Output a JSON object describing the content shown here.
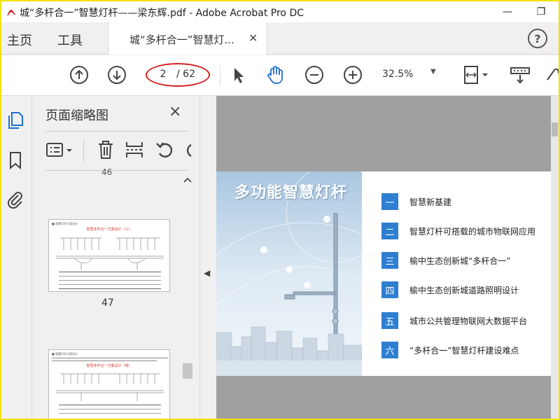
{
  "window": {
    "title": "城“多杆合一”智慧灯杆——梁东辉.pdf - Adobe Acrobat Pro DC",
    "minimize_glyph": "—",
    "restore_glyph": "❐"
  },
  "menu": {
    "home": "主页",
    "tools": "工具"
  },
  "doc_tab": {
    "label": "城“多杆合一”智慧灯...",
    "close": "×"
  },
  "help": "?",
  "toolbar": {
    "current_page": "2",
    "total_pages": "/ 62",
    "zoom": "32.5%",
    "zoom_caret": "▼"
  },
  "thumbnails": {
    "title": "页面缩略图",
    "close": "×",
    "prev_page_number": "46",
    "page_47_label": "47",
    "thumb1_title": "智慧多杆合一方案设计（三）",
    "thumb2_title": "智慧多杆合一方案设计（四）"
  },
  "splitter_arrow": "◀",
  "page": {
    "title": "多功能智慧灯杆",
    "toc": [
      {
        "num": "一",
        "text": "智慧新基建"
      },
      {
        "num": "二",
        "text": "智慧灯杆可搭载的城市物联网应用"
      },
      {
        "num": "三",
        "text": "榆中生态创新城“多杆合一”"
      },
      {
        "num": "四",
        "text": "榆中生态创新城道路照明设计"
      },
      {
        "num": "五",
        "text": "城市公共管理物联网大数据平台"
      },
      {
        "num": "六",
        "text": "“多杆合一”智慧灯杆建设难点"
      }
    ]
  },
  "colors": {
    "accent": "#2f7fd1",
    "highlight_ring": "#d42020",
    "frame": "#f2e200"
  }
}
